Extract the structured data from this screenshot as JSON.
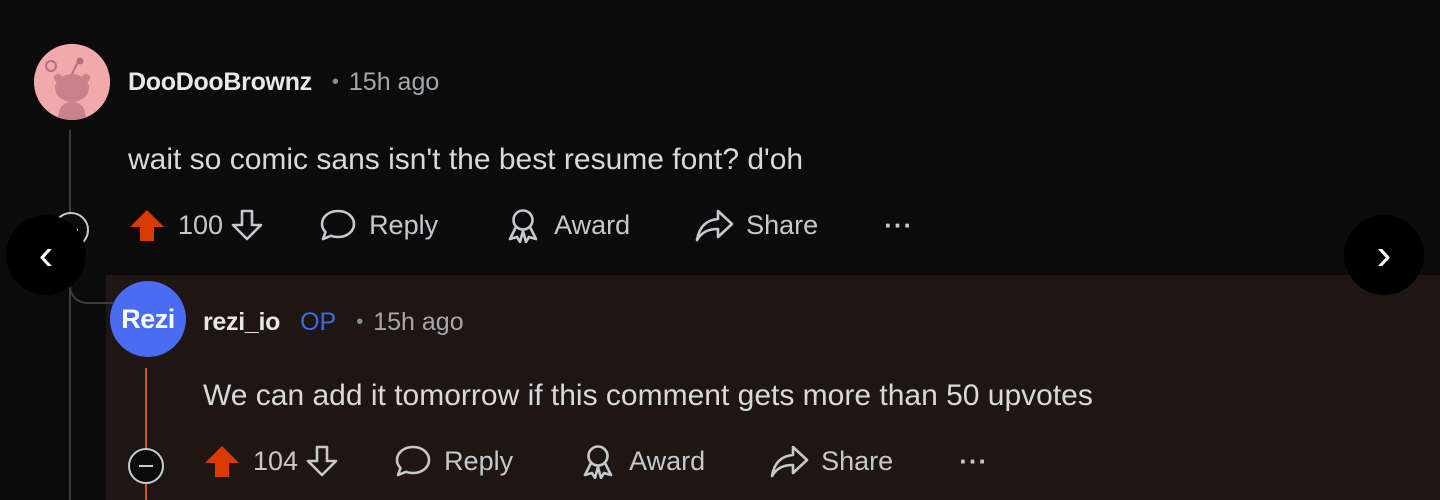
{
  "comment": {
    "username": "DooDooBrownz",
    "separator": "•",
    "time": "15h ago",
    "body": "wait so comic sans isn't the best resume font? d'oh",
    "score": "100",
    "actions": {
      "reply": "Reply",
      "award": "Award",
      "share": "Share",
      "more": "···"
    }
  },
  "reply": {
    "avatar_text": "Rezi",
    "username": "rezi_io",
    "op_badge": "OP",
    "separator": "•",
    "time": "15h ago",
    "body": "We can add it tomorrow if this comment gets more than 50 upvotes",
    "score": "104",
    "actions": {
      "reply": "Reply",
      "award": "Award",
      "share": "Share",
      "more": "···"
    }
  },
  "navigation": {
    "prev": "‹",
    "next": "›"
  },
  "colors": {
    "background": "#0b0b0b",
    "reply_highlight": "#1f1613",
    "upvote": "#d93a00",
    "op": "#3d6be0",
    "avatar_1": "#f2a9ab",
    "avatar_2": "#4a6cf2"
  },
  "icons": [
    "upvote-icon",
    "downvote-icon",
    "reply-bubble-icon",
    "award-icon",
    "share-arrow-icon",
    "collapse-icon",
    "chevron-left-icon",
    "chevron-right-icon"
  ]
}
